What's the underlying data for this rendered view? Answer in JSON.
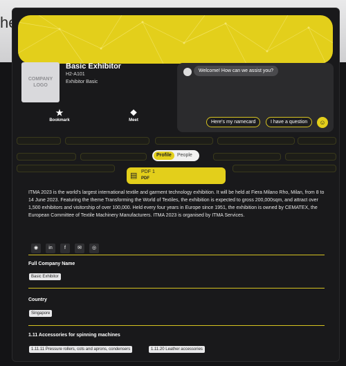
{
  "exhibitor": {
    "name": "Basic Exhibitor",
    "code": "H2-A101",
    "type": "Exhibitor Basic",
    "logo_text": "COMPANY LOGO"
  },
  "actions": {
    "bookmark": "Bookmark",
    "meet": "Meet"
  },
  "chat": {
    "greeting": "Welcome! How can we assist you?",
    "namecard_button": "Here's my namecard",
    "question_button": "I have a question"
  },
  "tabs": {
    "profile": "Profile",
    "people": "People"
  },
  "document": {
    "name": "PDF 1",
    "type": "PDF"
  },
  "description": "ITMA 2023 is the world's largest international textile and garment technology exhibition. It will be held at Fiera Milano Rho, Milan, from 8 to 14 June 2023. Featuring the theme Transforming the World of Textiles, the exhibition is expected to gross 200,000sqm, and attract over 1,500 exhibitors and visitorship of over 100,000. Held every four years in Europe since 1951, the exhibition is owned by CEMATEX, the European Committee of Textile Machinery Manufacturers. ITMA 2023 is organised by ITMA Services.",
  "details": {
    "company_label": "Full Company Name",
    "company_value": "Basic Exhibitor",
    "country_label": "Country",
    "country_value": "Singapore",
    "category_label": "1.11 Accessories for spinning machines",
    "category_values": [
      "1.11.11 Pressure rollers, cots and aprons, condensers",
      "1.11.20 Leather accessories"
    ]
  },
  "colors": {
    "accent": "#e3cf1b",
    "panel": "#19191b"
  }
}
